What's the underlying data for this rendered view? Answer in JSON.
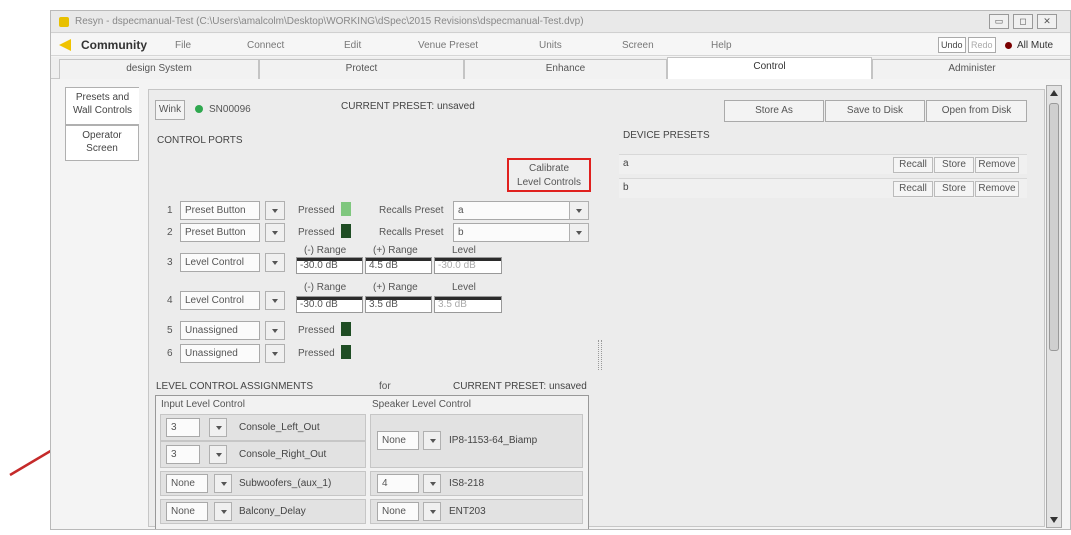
{
  "window": {
    "title": "Resyn - dspecmanual-Test (C:\\Users\\amalcolm\\Desktop\\WORKING\\dSpec\\2015 Revisions\\dspecmanual-Test.dvp)",
    "controls": [
      "minimize-icon",
      "maximize-icon",
      "close-icon"
    ]
  },
  "menubar": {
    "logo": "Community",
    "items": [
      "File",
      "Connect",
      "Edit",
      "Venue Preset",
      "Units",
      "Screen",
      "Help"
    ],
    "undo": "Undo",
    "redo": "Redo",
    "all_mute": "All Mute"
  },
  "tabs": [
    "design System",
    "Protect",
    "Enhance",
    "Control",
    "Administer"
  ],
  "side_tabs": [
    {
      "line1": "Presets and",
      "line2": "Wall Controls"
    },
    {
      "line1": "Operator",
      "line2": "Screen"
    }
  ],
  "device": {
    "wink": "Wink",
    "serial": "SN00096",
    "current_preset": "CURRENT PRESET: unsaved",
    "status_color": "#2fa84f"
  },
  "actions": {
    "store_as": "Store As",
    "save_to_disk": "Save to Disk",
    "open_from_disk": "Open from Disk"
  },
  "control_ports": {
    "heading": "CONTROL PORTS",
    "calibrate_line1": "Calibrate",
    "calibrate_line2": "Level Controls",
    "range_minus": "(-) Range",
    "range_plus": "(+) Range",
    "level": "Level",
    "pressed": "Pressed",
    "recalls_preset": "Recalls Preset",
    "ports": [
      {
        "num": "1",
        "type": "Preset Button",
        "recall": "a"
      },
      {
        "num": "2",
        "type": "Preset Button",
        "recall": "b"
      },
      {
        "num": "3",
        "type": "Level Control",
        "min": "-30.0 dB",
        "max": "4.5 dB",
        "level": "-30.0 dB"
      },
      {
        "num": "4",
        "type": "Level Control",
        "min": "-30.0 dB",
        "max": "3.5 dB",
        "level": "3.5 dB"
      },
      {
        "num": "5",
        "type": "Unassigned"
      },
      {
        "num": "6",
        "type": "Unassigned"
      }
    ]
  },
  "level_assignments": {
    "heading": "LEVEL CONTROL ASSIGNMENTS",
    "for": "for",
    "current_preset": "CURRENT PRESET: unsaved",
    "input_header": "Input Level Control",
    "speaker_header": "Speaker Level Control",
    "inputs": [
      {
        "value": "3",
        "name": "Console_Left_Out"
      },
      {
        "value": "3",
        "name": "Console_Right_Out"
      },
      {
        "value": "None",
        "name": "Subwoofers_(aux_1)"
      },
      {
        "value": "None",
        "name": "Balcony_Delay"
      }
    ],
    "speakers": [
      {
        "value": "None",
        "name": "IP8-1153-64_Biamp"
      },
      {
        "value": "4",
        "name": "IS8-218"
      },
      {
        "value": "None",
        "name": "ENT203"
      }
    ]
  },
  "device_presets": {
    "heading": "DEVICE PRESETS",
    "recall": "Recall",
    "store": "Store",
    "remove": "Remove",
    "items": [
      "a",
      "b"
    ]
  },
  "colors": {
    "highlight_box": "#e0201e",
    "arrow": "#c52a2a",
    "led_dark": "#1f4d24",
    "led_light": "#7fc77e"
  }
}
